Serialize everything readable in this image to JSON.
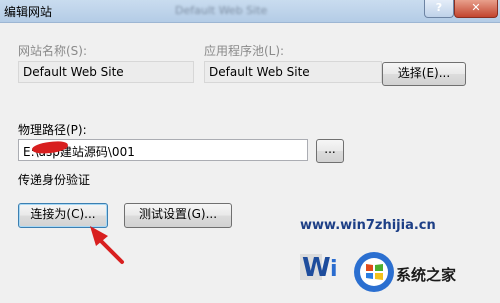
{
  "window": {
    "title": "编辑网站",
    "blurred_title_text": "Default Web Site"
  },
  "site_name": {
    "label": "网站名称(S):",
    "value": "Default Web Site"
  },
  "app_pool": {
    "label": "应用程序池(L):",
    "value": "Default Web Site",
    "select_button": "选择(E)..."
  },
  "physical_path": {
    "label": "物理路径(P):",
    "value": "E:\\asp建站源码\\001",
    "browse_button": "..."
  },
  "pass_through_auth": {
    "label": "传递身份验证"
  },
  "buttons": {
    "connect_as": "连接为(C)...",
    "test_settings": "测试设置(G)..."
  },
  "watermark": {
    "url": "www.win7zhijia.cn",
    "brand": "系统之家"
  },
  "colors": {
    "arrow": "#d81f1f",
    "watermark": "#1d3f86"
  }
}
